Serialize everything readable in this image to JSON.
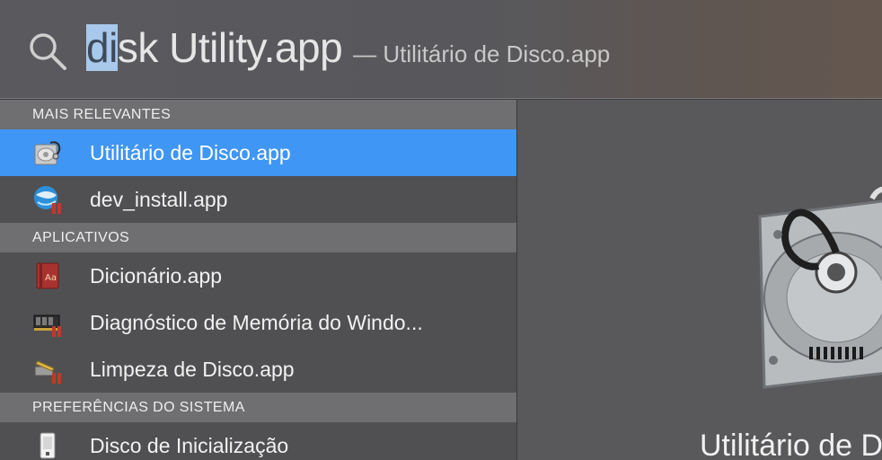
{
  "search": {
    "typed_selected": "di",
    "typed_rest": "sk Utility.app",
    "hint": "— Utilitário de Disco.app"
  },
  "sections": [
    {
      "header": "MAIS RELEVANTES",
      "items": [
        {
          "label": "Utilitário de Disco.app",
          "icon": "disk-utility-icon",
          "selected": true
        },
        {
          "label": "dev_install.app",
          "icon": "installer-globe-icon",
          "selected": false
        }
      ]
    },
    {
      "header": "APLICATIVOS",
      "items": [
        {
          "label": "Dicionário.app",
          "icon": "dictionary-icon",
          "selected": false
        },
        {
          "label": "Diagnóstico de Memória do Windo...",
          "icon": "memory-chip-icon",
          "selected": false
        },
        {
          "label": "Limpeza de Disco.app",
          "icon": "disk-cleanup-icon",
          "selected": false
        }
      ]
    },
    {
      "header": "PREFERÊNCIAS DO SISTEMA",
      "items": [
        {
          "label": "Disco de Inicialização",
          "icon": "startup-disk-icon",
          "selected": false
        }
      ]
    }
  ],
  "preview": {
    "title": "Utilitário de Disco",
    "icon": "disk-utility-large-icon"
  },
  "colors": {
    "selection": "#3f96f5",
    "text_selection": "#a8c8ec"
  }
}
